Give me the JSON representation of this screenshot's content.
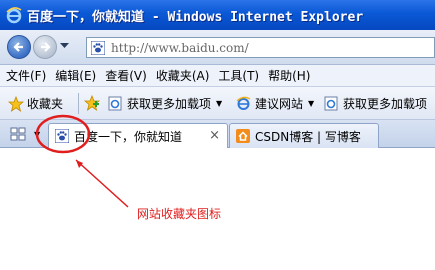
{
  "window": {
    "title": "百度一下，你就知道 - Windows Internet Explorer"
  },
  "address_bar": {
    "url": "http://www.baidu.com/",
    "icons": [
      "back-arrow-icon",
      "forward-arrow-icon",
      "baidu-paw-icon"
    ]
  },
  "menu": {
    "items": [
      "文件(F)",
      "编辑(E)",
      "查看(V)",
      "收藏夹(A)",
      "工具(T)",
      "帮助(H)"
    ]
  },
  "favorites_bar": {
    "favorites_label": "收藏夹",
    "items": [
      "获取更多加载项",
      "建议网站",
      "获取更多加载项"
    ]
  },
  "tabs": [
    {
      "label": "百度一下，你就知道",
      "active": true,
      "close": "×"
    },
    {
      "label": "CSDN博客 | 写博客",
      "active": false
    }
  ],
  "annotation": {
    "label": "网站收藏夹图标",
    "color": "#e01e1e"
  }
}
